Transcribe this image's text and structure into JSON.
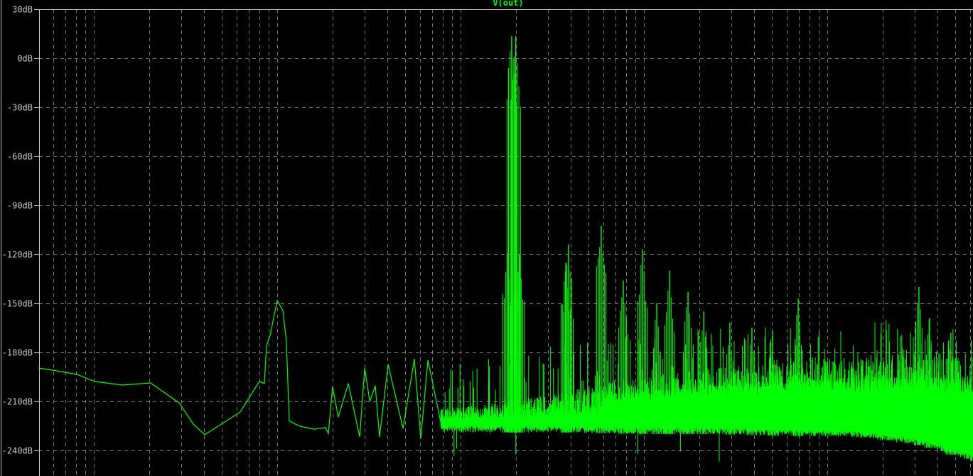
{
  "chart_data": {
    "type": "line",
    "title": "V(out)",
    "xlabel": "",
    "ylabel": "",
    "x_scale": "log",
    "x_unit": "Hz",
    "xlim": [
      50,
      6200000
    ],
    "ylim": [
      -250,
      30
    ],
    "y_ticks": [
      30,
      0,
      -30,
      -60,
      -90,
      -120,
      -150,
      -180,
      -210,
      -240
    ],
    "y_tick_labels": [
      "30dB",
      "0dB",
      "-30dB",
      "-60dB",
      "-90dB",
      "-120dB",
      "-150dB",
      "-180dB",
      "-210dB",
      "-240dB"
    ],
    "grid": true,
    "series_color": "#00ff00",
    "low_curve": [
      [
        50,
        -189.6
      ],
      [
        60,
        -190.9
      ],
      [
        81,
        -193.5
      ],
      [
        101,
        -197.8
      ],
      [
        143,
        -200
      ],
      [
        204,
        -198.7
      ],
      [
        292,
        -210.9
      ],
      [
        349,
        -223.9
      ],
      [
        403,
        -230.4
      ],
      [
        628,
        -216.5
      ],
      [
        800,
        -197.8
      ],
      [
        851,
        -199
      ],
      [
        875,
        -176
      ],
      [
        915,
        -169.6
      ],
      [
        1000,
        -148.3
      ],
      [
        1074,
        -154.3
      ],
      [
        1122,
        -173
      ],
      [
        1164,
        -222
      ],
      [
        1330,
        -225.2
      ],
      [
        1592,
        -227
      ],
      [
        1835,
        -226
      ],
      [
        1901,
        -229.6
      ],
      [
        2005,
        -201
      ],
      [
        2153,
        -219.6
      ],
      [
        2443,
        -199
      ],
      [
        2818,
        -231.7
      ],
      [
        3000,
        -189.6
      ],
      [
        3200,
        -210
      ],
      [
        3428,
        -200.4
      ],
      [
        3614,
        -231.7
      ],
      [
        4027,
        -187.4
      ],
      [
        4853,
        -226.5
      ],
      [
        5597,
        -184
      ],
      [
        6067,
        -232.6
      ],
      [
        6637,
        -184.8
      ],
      [
        7925,
        -226.5
      ]
    ],
    "tones": [
      {
        "freq": 18000,
        "db": -119
      },
      {
        "freq": 19000,
        "db": 13.5
      },
      {
        "freq": 20000,
        "db": 13.5
      },
      {
        "freq": 21000,
        "db": -120
      },
      {
        "freq": 37500,
        "db": -125
      },
      {
        "freq": 38800,
        "db": -114
      },
      {
        "freq": 58500,
        "db": -102.6
      },
      {
        "freq": 77200,
        "db": -136
      },
      {
        "freq": 98300,
        "db": -117
      },
      {
        "freq": 117500,
        "db": -150
      },
      {
        "freq": 138000,
        "db": -130
      },
      {
        "freq": 174000,
        "db": -143
      },
      {
        "freq": 212000,
        "db": -155
      },
      {
        "freq": 294000,
        "db": -162
      },
      {
        "freq": 388000,
        "db": -165
      },
      {
        "freq": 503000,
        "db": -167
      },
      {
        "freq": 694000,
        "db": -147
      },
      {
        "freq": 3160000,
        "db": -140
      },
      {
        "freq": 3610000,
        "db": -159
      },
      {
        "freq": 4720000,
        "db": -168
      }
    ],
    "noise_envelope": {
      "columns": [
        "freq",
        "floor_db",
        "band_top_db",
        "spike_top_db"
      ],
      "rows": [
        [
          7800,
          -229,
          -205,
          -190
        ],
        [
          16000,
          -229,
          -205,
          -180
        ],
        [
          38800,
          -229,
          -200,
          -175
        ],
        [
          95000,
          -230,
          -195,
          -170
        ],
        [
          230000,
          -230,
          -190,
          -165
        ],
        [
          560000,
          -231,
          -186,
          -162
        ],
        [
          1370000,
          -232,
          -183,
          -160
        ],
        [
          3300000,
          -237,
          -180,
          -158
        ],
        [
          6200000,
          -247,
          -178,
          -158
        ]
      ]
    }
  }
}
